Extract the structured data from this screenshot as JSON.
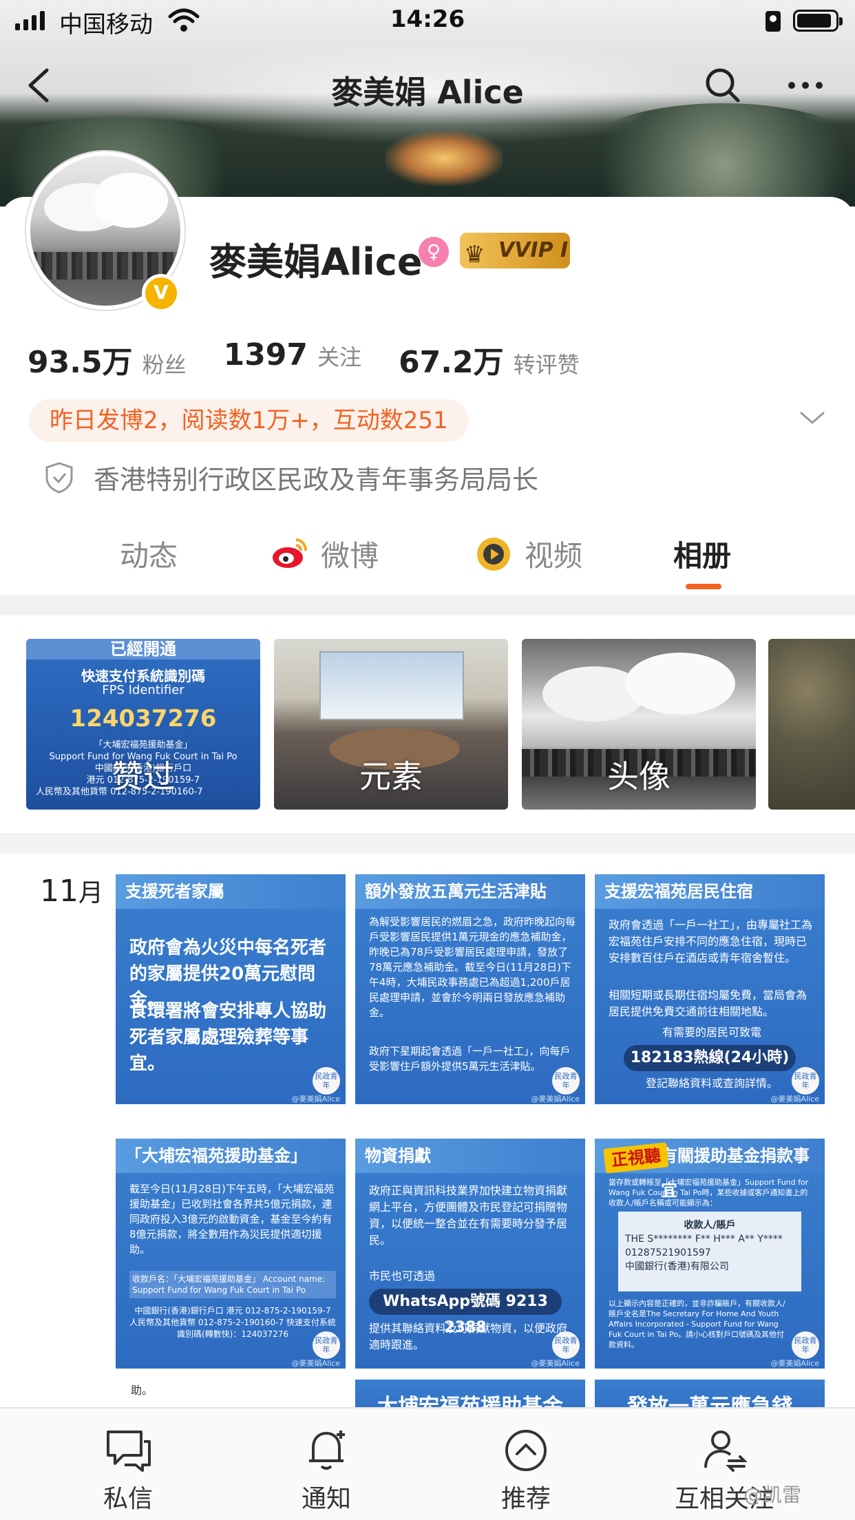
{
  "status_bar": {
    "carrier": "中国移动",
    "time": "14:26"
  },
  "nav": {
    "title": "麥美娟 Alice"
  },
  "profile": {
    "name": "麥美娟Alice",
    "verified_badge": "V",
    "vip_label": "VVIP I",
    "stats": [
      {
        "num": "93.5万",
        "label": "粉丝"
      },
      {
        "num": "1397",
        "label": "关注"
      },
      {
        "num": "67.2万",
        "label": "转评赞"
      }
    ],
    "highlight": "昨日发博2，阅读数1万+，互动数251",
    "verification": "香港特别行政区民政及青年事务局局长"
  },
  "tabs": [
    {
      "label": "动态",
      "icon": "none"
    },
    {
      "label": "微博",
      "icon": "weibo-icon"
    },
    {
      "label": "视频",
      "icon": "video-icon"
    },
    {
      "label": "相册",
      "icon": "none",
      "active": true
    }
  ],
  "albums": [
    {
      "label": "赞过",
      "header": "已經開通",
      "line1": "快速支付系統識別碼",
      "line2": "FPS Identifier",
      "number": "124037276",
      "detail1": "「大埔宏福苑援助基金」",
      "detail2": "Support Fund for Wang Fuk Court in Tai Po",
      "detail3": "中國銀行(香港)銀行戶口",
      "detail4": "港元 012-875-2-190159-7",
      "detail5": "人民幣及其他貨幣 012-875-2-190160-7"
    },
    {
      "label": "元素"
    },
    {
      "label": "头像"
    },
    {
      "label": ""
    }
  ],
  "month": {
    "num": "11",
    "unit": "月"
  },
  "posts": [
    {
      "title": "支援死者家屬",
      "p1": "政府會為火災中每名死者的家屬提供20萬元慰問金。",
      "p2": "食環署將會安排專人協助死者家屬處理殮葬等事宜。"
    },
    {
      "title": "額外發放五萬元生活津貼",
      "p1": "為解受影響居民的燃眉之急，政府昨晚起向每戶受影響居民提供1萬元現金的應急補助金，昨晚已為78戶受影響居民處理申請，發放了78萬元應急補助金。截至今日(11月28日)下午4時，大埔民政事務處已為超過1,200戶居民處理申請，並會於今明兩日發放應急補助金。",
      "p2": "政府下星期起會透過「一戶一社工」，向每戶受影響住戶額外提供5萬元生活津貼。"
    },
    {
      "title": "支援宏福苑居民住宿",
      "p1": "政府會透過「一戶一社工」，由專屬社工為宏福苑住戶安排不同的應急住宿，現時已安排數百住戶在酒店或青年宿舍暫住。",
      "p2": "相關短期或長期住宿均屬免費，當局會為居民提供免費交通前往相關地點。",
      "p3": "有需要的居民可致電",
      "hotline": "182183熱線(24小時)",
      "p4": "登記聯絡資料或查詢詳情。"
    },
    {
      "title": "「大埔宏福苑援助基金」",
      "p1": "截至今日(11月28日)下午五時，「大埔宏福苑援助基金」已收到社會各界共5億元捐款，連同政府投入3億元的啟動資金，基金至今約有8億元捐款，將全數用作為災民提供適切援助。",
      "p2": "收款戶名：「大埔宏福苑援助基金」 Account name: Support Fund for Wang Fuk Court in Tai Po",
      "p3": "中國銀行(香港)銀行戶口 港元 012-875-2-190159-7 人民幣及其他貨幣 012-875-2-190160-7 快速支付系統識別碼(轉數快)：124037276"
    },
    {
      "title": "物資捐獻",
      "p1": "政府正與資訊科技業界加快建立物資捐獻網上平台，方便團體及市民登記可捐贈物資，以便統一整合並在有需要時分發予居民。",
      "p2": "市民也可透過",
      "hotline": "WhatsApp號碼 9213 2388",
      "p3": "提供其聯絡資料及可捐獻物資，以便政府適時跟進。"
    },
    {
      "title": "有關援助基金捐款事宜",
      "badge": "正視聽",
      "p1": "當存款或轉賬至「大埔宏福苑援助基金」Support Fund for Wang Fuk Court in Tai Po時，某些收據或客戶通知書上的收款人/賬戶名稱或可能顯示為：",
      "panel1": "收款人/賬戶",
      "panel2": "THE S******** F** H*** A** Y****",
      "panel3": "01287521901597",
      "panel4": "中國銀行(香港)有限公司",
      "p2": "以上顯示內容是正確的，並非詐騙賬戶，有關收款人/賬戶全名是The Secretary For Home And Youth Affairs Incorporated - Support Fund for Wang Fuk Court in Tai Po。請小心核對戶口號碼及其他付款資料。"
    }
  ],
  "seal_text": "民政青年",
  "watermark": "@麥美娟Alice",
  "peeks": [
    {
      "text": "助。"
    },
    {
      "text": "大埔宏福苑援助基金"
    },
    {
      "text": "發放一萬元應急錢"
    }
  ],
  "bottom_nav": [
    {
      "label": "私信",
      "icon": "message-icon"
    },
    {
      "label": "通知",
      "icon": "bell-icon"
    },
    {
      "label": "推荐",
      "icon": "recommend-icon"
    },
    {
      "label": "互相关注",
      "icon": "mutual-follow-icon"
    }
  ],
  "credit": "@凯雷"
}
